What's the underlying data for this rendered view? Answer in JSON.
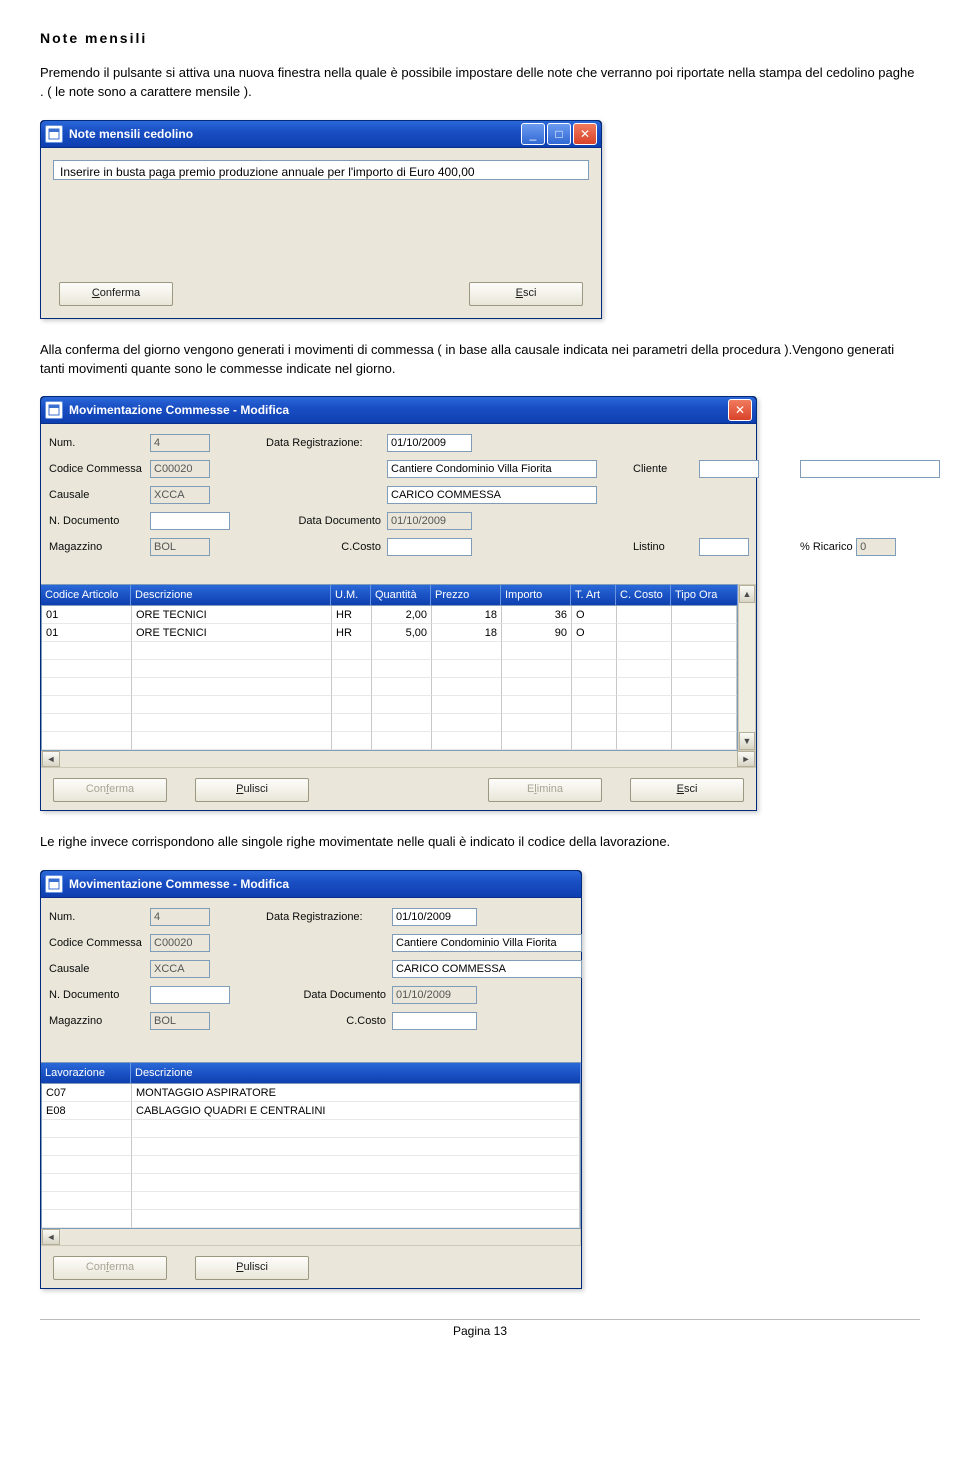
{
  "heading": "Note mensili",
  "para1": "Premendo il pulsante si attiva una nuova finestra nella quale è possibile impostare delle note che verranno poi riportate nella stampa del cedolino paghe . ( le note sono a carattere mensile ).",
  "para2": "Alla conferma del giorno vengono generati i movimenti di commessa ( in base alla causale indicata nei parametri della procedura ).Vengono generati tanti movimenti quante sono le commesse indicate nel giorno.",
  "para3": "Le righe invece corrispondono alle singole righe movimentate nelle quali è indicato il codice della lavorazione.",
  "notes_win": {
    "title": "Note mensili cedolino",
    "text": "Inserire in busta paga premio produzione annuale per l'importo di Euro 400,00",
    "confirm": "Conferma",
    "exit": "Esci"
  },
  "mov_win": {
    "title": "Movimentazione Commesse - Modifica",
    "labels": {
      "num": "Num.",
      "data_reg": "Data Registrazione:",
      "cod_comm": "Codice Commessa",
      "cantiere": "Cantiere Condominio Villa Fiorita",
      "cliente": "Cliente",
      "causale": "Causale",
      "carico": "CARICO COMMESSA",
      "ndoc": "N. Documento",
      "data_doc": "Data Documento",
      "magazzino": "Magazzino",
      "ccosto": "C.Costo",
      "listino": "Listino",
      "ricarico": "% Ricarico"
    },
    "values": {
      "num": "4",
      "data_reg": "01/10/2009",
      "cod_comm": "C00020",
      "causale": "XCCA",
      "data_doc": "01/10/2009",
      "magazzino": "BOL",
      "ricarico": "0"
    },
    "headers": [
      "Codice Articolo",
      "Descrizione",
      "U.M.",
      "Quantità",
      "Prezzo",
      "Importo",
      "T. Art",
      "C. Costo",
      "Tipo Ora"
    ],
    "rows": [
      {
        "cod": "01",
        "desc": "ORE TECNICI",
        "um": "HR",
        "q": "2,00",
        "p": "18",
        "imp": "36",
        "tart": "O"
      },
      {
        "cod": "01",
        "desc": "ORE TECNICI",
        "um": "HR",
        "q": "5,00",
        "p": "18",
        "imp": "90",
        "tart": "O"
      }
    ],
    "buttons": {
      "conferma": "Conferma",
      "pulisci": "Pulisci",
      "elimina": "Elimina",
      "esci": "Esci"
    }
  },
  "mov_win2": {
    "headers": [
      "Lavorazione",
      "Descrizione"
    ],
    "rows": [
      {
        "lav": "C07",
        "desc": "MONTAGGIO ASPIRATORE"
      },
      {
        "lav": "E08",
        "desc": "CABLAGGIO QUADRI E CENTRALINI"
      }
    ]
  },
  "footer": "Pagina 13"
}
